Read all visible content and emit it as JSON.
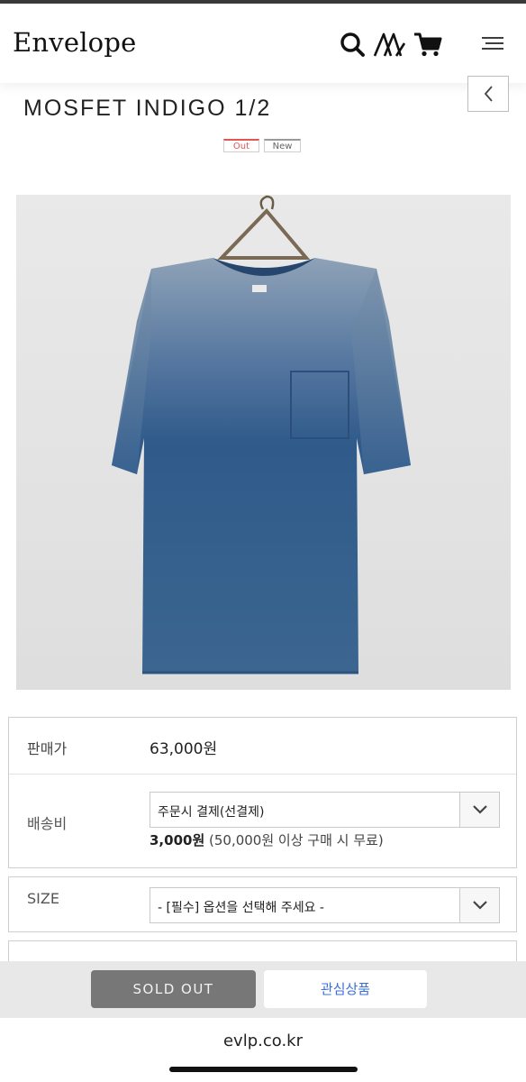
{
  "header": {
    "logo": "Envelope",
    "icons": [
      "search-icon",
      "brand-mark-icon",
      "cart-icon",
      "menu-icon"
    ]
  },
  "product": {
    "title": "MOSFET INDIGO 1/2",
    "badges": {
      "out": "Out",
      "new": "New"
    }
  },
  "info": {
    "price_label": "판매가",
    "price_value": "63,000원",
    "shipping_label": "배송비",
    "shipping_select": "주문시 결제(선결제)",
    "shipping_fee": "3,000원",
    "shipping_condition": " (50,000원 이상 구매 시 무료)",
    "size_label": "SIZE",
    "size_select": "- [필수] 옵션을 선택해 주세요 -"
  },
  "actions": {
    "sold_out": "SOLD OUT",
    "wishlist": "관심상품"
  },
  "browser": {
    "url": "evlp.co.kr"
  },
  "colors": {
    "badge_out": "#e25555",
    "wishlist_text": "#3b6fd6",
    "sold_out_bg": "#777777"
  }
}
